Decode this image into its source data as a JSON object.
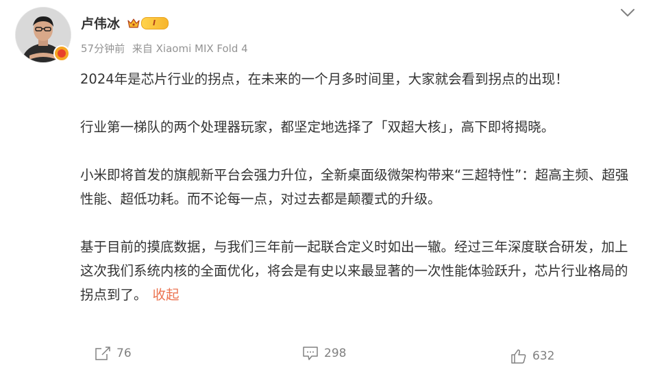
{
  "post": {
    "author": {
      "name": "卢伟冰",
      "vip_level": "I",
      "verified": true
    },
    "time": "57分钟前",
    "source": "来自 Xiaomi MIX Fold 4",
    "paragraphs": [
      "2024年是芯片行业的拐点，在未来的一个月多时间里，大家就会看到拐点的出现！",
      "行业第一梯队的两个处理器玩家，都坚定地选择了「双超大核」，高下即将揭晓。",
      "小米即将首发的旗舰新平台会强力升位，全新桌面级微架构带来“三超特性”：超高主频、超强性能、超低功耗。而不论每一点，对过去都是颠覆式的升级。",
      "基于目前的摸底数据，与我们三年前一起联合定义时如出一辙。经过三年深度联合研发，加上这次我们系统内核的全面优化，将会是有史以来最显著的一次性能体验跃升，芯片行业格局的拐点到了。"
    ],
    "collapse_label": "收起",
    "stats": {
      "reposts": "76",
      "comments": "298",
      "likes": "632"
    }
  },
  "icons": {
    "menu": "chevron-down-icon",
    "repost": "share-icon",
    "comment": "comment-icon",
    "like": "thumbs-up-icon",
    "vip": "crown-icon"
  },
  "colors": {
    "accent_link": "#eb7350",
    "meta_text": "#939393",
    "body_text": "#333333",
    "action_text": "#808080"
  }
}
